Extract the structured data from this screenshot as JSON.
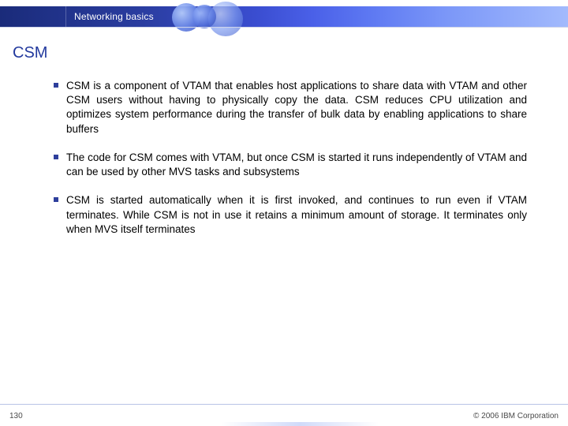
{
  "header": {
    "breadcrumb": "Networking basics"
  },
  "title": "CSM",
  "bullets": [
    "CSM is a component of VTAM that enables host applications to share data with VTAM and other CSM users without having to physically copy the data. CSM reduces CPU utilization and optimizes system performance during the transfer of bulk data by enabling applications to share buffers",
    "The code for CSM comes with VTAM, but once CSM is started it runs independently of VTAM and can be used by other MVS tasks and subsystems",
    "CSM is started automatically when it is first invoked, and continues to run even if VTAM terminates. While CSM is not in use it retains a minimum amount of storage. It terminates only when MVS itself terminates"
  ],
  "footer": {
    "page": "130",
    "copyright": "© 2006 IBM Corporation"
  },
  "colors": {
    "accent": "#2e3f9c"
  }
}
